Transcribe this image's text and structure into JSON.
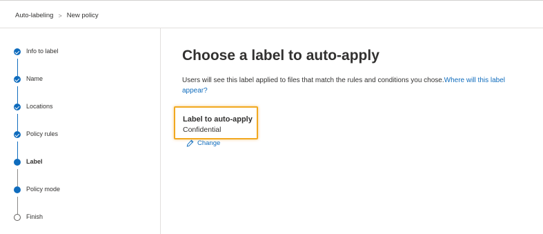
{
  "breadcrumb": {
    "items": [
      "Auto-labeling",
      "New policy"
    ],
    "separator": ">"
  },
  "steps": [
    {
      "label": "Info to label",
      "state": "done"
    },
    {
      "label": "Name",
      "state": "done"
    },
    {
      "label": "Locations",
      "state": "done"
    },
    {
      "label": "Policy rules",
      "state": "done"
    },
    {
      "label": "Label",
      "state": "current"
    },
    {
      "label": "Policy mode",
      "state": "upcoming"
    },
    {
      "label": "Finish",
      "state": "pending"
    }
  ],
  "main": {
    "title": "Choose a label to auto-apply",
    "description": "Users will see this label applied to files that match the rules and conditions you chose.",
    "description_link": "Where will this label appear?",
    "field_label": "Label to auto-apply",
    "field_value": "Confidential",
    "change_label": "Change"
  },
  "colors": {
    "accent": "#0f6cbd",
    "highlight": "#f1a81f"
  }
}
